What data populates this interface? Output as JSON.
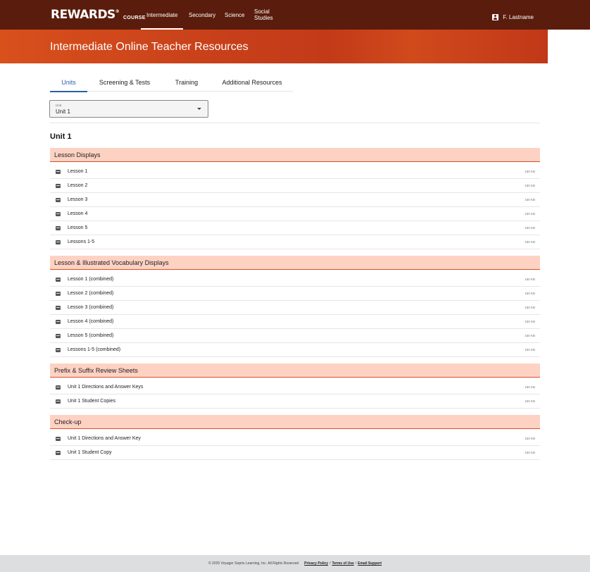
{
  "header": {
    "logo": "REWARDS",
    "logo_mark": "®",
    "course_label": "COURSE",
    "nav": [
      "Intermediate",
      "Secondary",
      "Science",
      "Social Studies"
    ],
    "active_nav": "Intermediate",
    "user_name": "F. Lastname"
  },
  "hero": {
    "title": "Intermediate Online Teacher Resources"
  },
  "tabs": [
    "Units",
    "Screening & Tests",
    "Training",
    "Additional Resources"
  ],
  "active_tab": "Units",
  "unit_select": {
    "label": "Unit",
    "value": "Unit 1"
  },
  "unit_heading": "Unit 1",
  "sections": [
    {
      "title": "Lesson Displays",
      "items": [
        {
          "label": "Lesson 1",
          "size": "150 KB"
        },
        {
          "label": "Lesson 2",
          "size": "150 KB"
        },
        {
          "label": "Lesson 3",
          "size": "150 KB"
        },
        {
          "label": "Lesson 4",
          "size": "150 KB"
        },
        {
          "label": "Lesson 5",
          "size": "150 KB"
        },
        {
          "label": "Lessons 1-5",
          "size": "150 KB"
        }
      ]
    },
    {
      "title": "Lesson & Illustrated Vocabulary Displays",
      "items": [
        {
          "label": "Lesson 1 (combined)",
          "size": "150 KB"
        },
        {
          "label": "Lesson 2 (combined)",
          "size": "150 KB"
        },
        {
          "label": "Lesson 3 (combined)",
          "size": "150 KB"
        },
        {
          "label": "Lesson 4 (combined)",
          "size": "150 KB"
        },
        {
          "label": "Lesson 5 (combined)",
          "size": "150 KB"
        },
        {
          "label": "Lessons 1-5 (combined)",
          "size": "150 KB"
        }
      ]
    },
    {
      "title": "Prefix & Suffix Review Sheets",
      "items": [
        {
          "label": "Unit 1 Directions and Answer Keys",
          "size": "150 KB"
        },
        {
          "label": "Unit 1 Student Copies",
          "size": "150 KB"
        }
      ]
    },
    {
      "title": "Check-up",
      "items": [
        {
          "label": "Unit 1 Directions and Answer Key",
          "size": "150 KB"
        },
        {
          "label": "Unit 1 Student Copy",
          "size": "150 KB"
        }
      ]
    }
  ],
  "footer": {
    "copyright": "© 2025 Voyager Sopris Learning, Inc. All Rights Reserved",
    "links": [
      "Privacy Policy",
      "Terms of Use",
      "Email Support"
    ],
    "separator": "/"
  },
  "colors": {
    "topbar": "#5a1c0c",
    "hero": "#c8401a",
    "section_bg": "#fdd2c3",
    "section_border": "#d8502a",
    "tab_active": "#2a5fa8"
  }
}
